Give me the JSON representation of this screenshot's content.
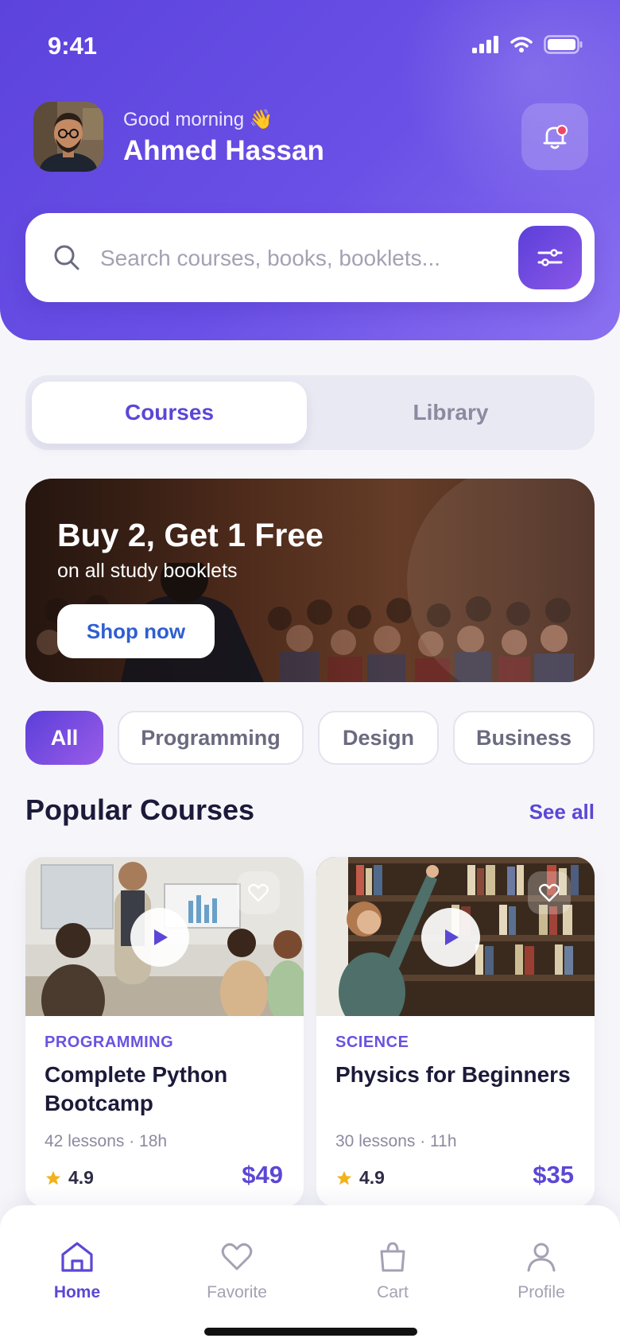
{
  "status": {
    "time": "9:41"
  },
  "user": {
    "greeting": "Good morning 👋",
    "name": "Ahmed Hassan"
  },
  "search": {
    "placeholder": "Search courses, books, booklets..."
  },
  "segments": [
    {
      "label": "Courses",
      "active": true
    },
    {
      "label": "Library",
      "active": false
    }
  ],
  "banner": {
    "title": "Buy 2, Get 1 Free",
    "subtitle": "on all study booklets",
    "cta": "Shop now"
  },
  "categories": [
    {
      "label": "All",
      "active": true
    },
    {
      "label": "Programming",
      "active": false
    },
    {
      "label": "Design",
      "active": false
    },
    {
      "label": "Business",
      "active": false
    }
  ],
  "popular": {
    "title": "Popular Courses",
    "see_all": "See all",
    "courses": [
      {
        "category": "PROGRAMMING",
        "title": "Complete Python Bootcamp",
        "lessons": "42 lessons · 18h",
        "rating": "4.9",
        "price": "$49"
      },
      {
        "category": "SCIENCE",
        "title": "Physics for Beginners",
        "lessons": "30 lessons · 11h",
        "rating": "4.9",
        "price": "$35"
      }
    ]
  },
  "tabbar": [
    {
      "label": "Home",
      "icon": "home-icon",
      "active": true
    },
    {
      "label": "Favorite",
      "icon": "heart-icon",
      "active": false
    },
    {
      "label": "Cart",
      "icon": "bag-icon",
      "active": false
    },
    {
      "label": "Profile",
      "icon": "user-icon",
      "active": false
    }
  ],
  "colors": {
    "primary": "#5b47d6",
    "header_gradient_start": "#5c43dc",
    "header_gradient_end": "#8a70f0",
    "star": "#f2b21b"
  }
}
